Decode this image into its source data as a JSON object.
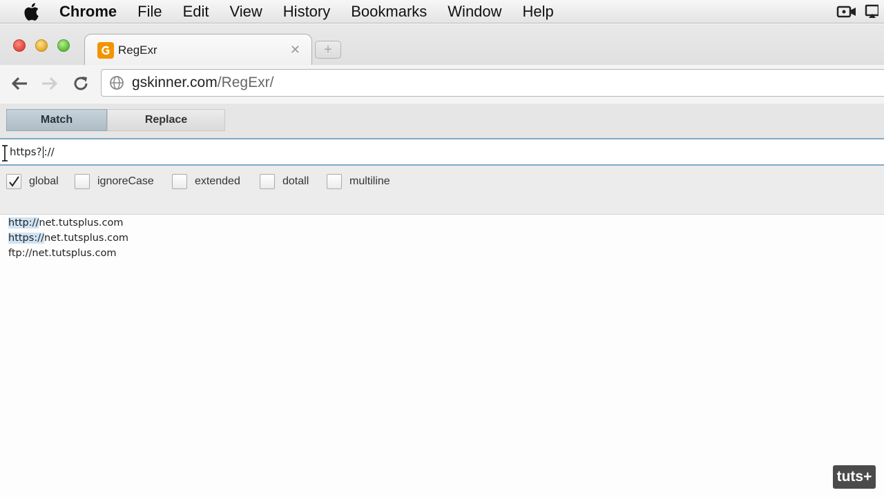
{
  "menubar": {
    "apple_icon": "apple-logo-icon",
    "items": [
      "Chrome",
      "File",
      "Edit",
      "View",
      "History",
      "Bookmarks",
      "Window",
      "Help"
    ]
  },
  "browser": {
    "tab": {
      "title": "RegExr",
      "favicon": "regexr-favicon-icon"
    },
    "url": {
      "host": "gskinner.com",
      "path": "/RegExr/"
    }
  },
  "app": {
    "modes": {
      "match": "Match",
      "replace": "Replace",
      "active": "Match"
    },
    "regex": {
      "before_caret": "https?",
      "after_caret": "://"
    },
    "flags": [
      {
        "label": "global",
        "checked": true
      },
      {
        "label": "ignoreCase",
        "checked": false
      },
      {
        "label": "extended",
        "checked": false
      },
      {
        "label": "dotall",
        "checked": false
      },
      {
        "label": "multiline",
        "checked": false
      }
    ],
    "text_lines": [
      {
        "match": "http://",
        "rest": "net.tutsplus.com"
      },
      {
        "match": "https://",
        "rest": "net.tutsplus.com"
      },
      {
        "match": "",
        "rest": "ftp://net.tutsplus.com"
      }
    ]
  },
  "watermark": {
    "text": "tuts+"
  },
  "colors": {
    "match_highlight": "#cfe3f3",
    "active_mode": "#b7c4ce",
    "input_border": "#7fa9c8",
    "favicon": "#f29400"
  }
}
